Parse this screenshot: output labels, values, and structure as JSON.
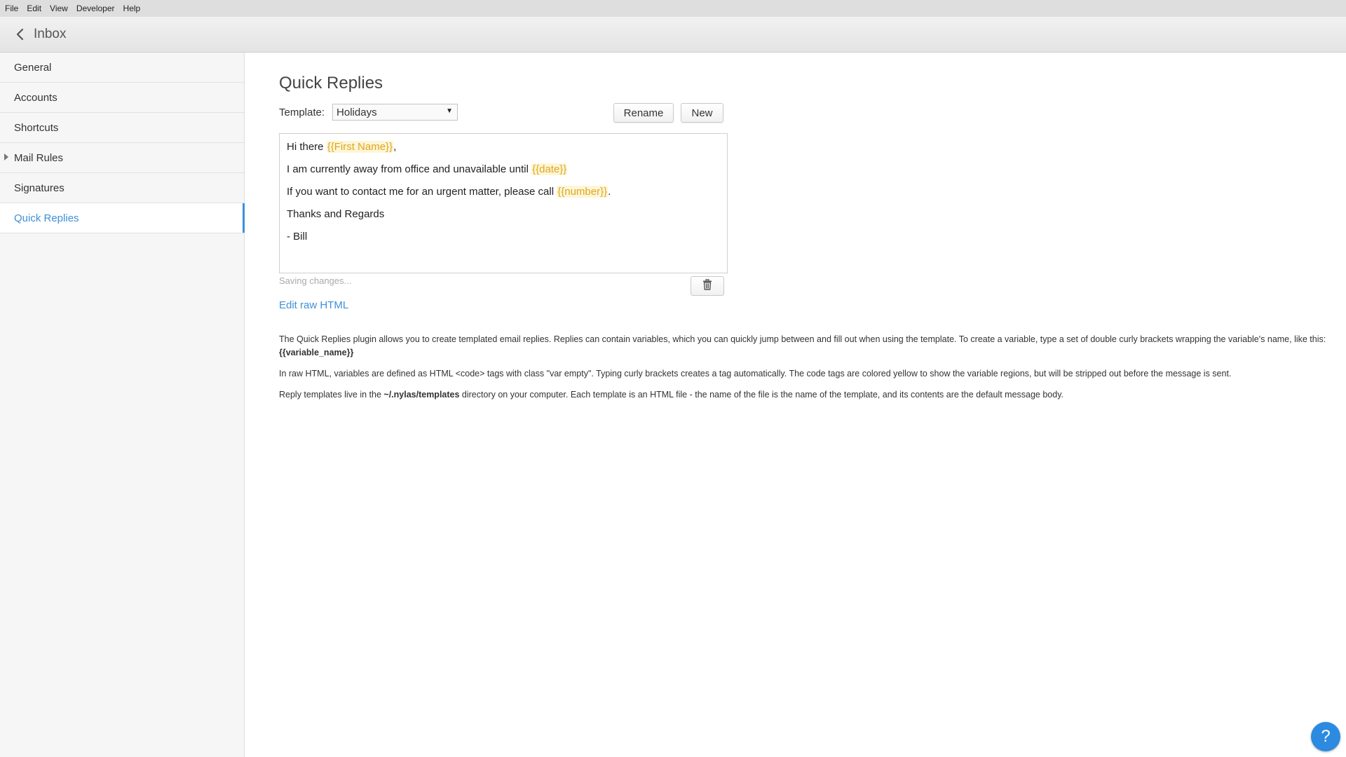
{
  "menubar": {
    "items": [
      "File",
      "Edit",
      "View",
      "Developer",
      "Help"
    ]
  },
  "toolbar": {
    "back_label": "Inbox"
  },
  "sidebar": {
    "items": [
      {
        "label": "General"
      },
      {
        "label": "Accounts"
      },
      {
        "label": "Shortcuts"
      },
      {
        "label": "Mail Rules"
      },
      {
        "label": "Signatures"
      },
      {
        "label": "Quick Replies"
      }
    ],
    "active_index": 5
  },
  "main": {
    "title": "Quick Replies",
    "template_label": "Template:",
    "template_selected": "Holidays",
    "rename_label": "Rename",
    "new_label": "New",
    "editor": {
      "line1_prefix": "Hi there ",
      "line1_var": "{{First Name}}",
      "line1_suffix": ",",
      "line2_prefix": "I am currently away from office and unavailable until ",
      "line2_var": "{{date}}",
      "line3_prefix": "If you want to contact me for an urgent matter, please call ",
      "line3_var": "{{number}}",
      "line3_suffix": ".",
      "line4": "Thanks and Regards",
      "line5": "- Bill"
    },
    "saving_status": "Saving changes...",
    "edit_raw_label": "Edit raw HTML",
    "help": {
      "p1_text": "The Quick Replies plugin allows you to create templated email replies. Replies can contain variables, which you can quickly jump between and fill out when using the template. To create a variable, type a set of double curly brackets wrapping the variable's name, like this: ",
      "p1_bold": "{{variable_name}}",
      "p2_text": "In raw HTML, variables are defined as HTML <code> tags with class \"var empty\". Typing curly brackets creates a tag automatically. The code tags are colored yellow to show the variable regions, but will be stripped out before the message is sent.",
      "p3_prefix": "Reply templates live in the ",
      "p3_bold": "~/.nylas/templates",
      "p3_suffix": " directory on your computer. Each template is an HTML file - the name of the file is the name of the template, and its contents are the default message body."
    }
  },
  "help_button": {
    "label": "?"
  },
  "colors": {
    "accent": "#3f8fd9",
    "variable": "#e0a722",
    "help_button": "#2c8ae0"
  },
  "icons": {
    "back": "chevron-left-icon",
    "dropdown": "caret-down-icon",
    "trash": "trash-icon",
    "expander": "triangle-right-icon"
  }
}
